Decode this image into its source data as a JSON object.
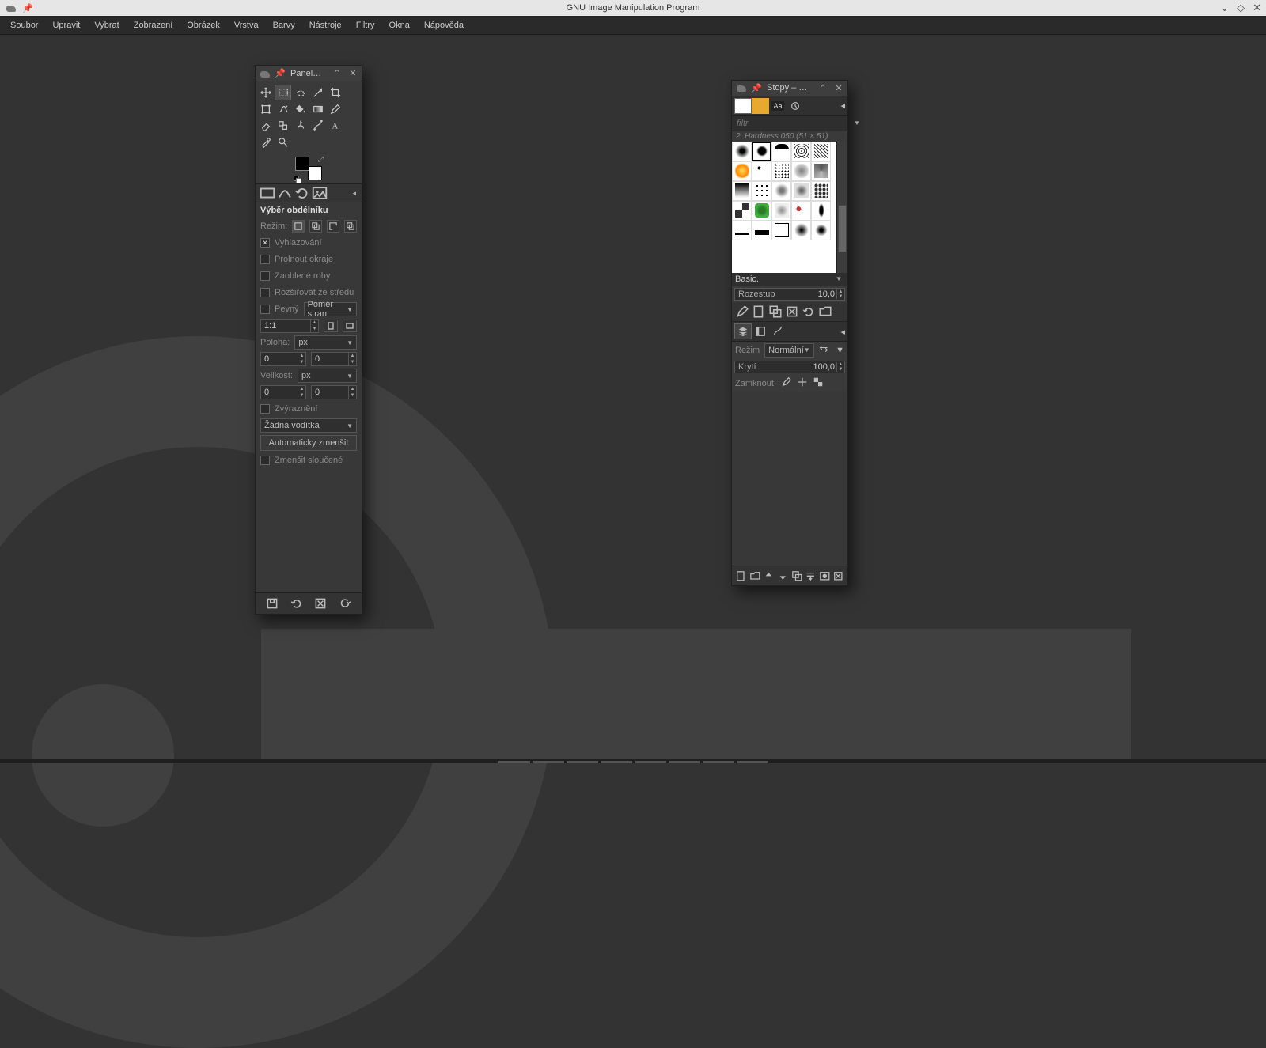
{
  "app": {
    "title": "GNU Image Manipulation Program"
  },
  "menu": [
    "Soubor",
    "Upravit",
    "Vybrat",
    "Zobrazení",
    "Obrázek",
    "Vrstva",
    "Barvy",
    "Nástroje",
    "Filtry",
    "Okna",
    "Nápověda"
  ],
  "toolbox_panel": {
    "title": "Panel…troje",
    "options_title": "Výběr obdélníku",
    "mode_label": "Režim:",
    "antialias": "Vyhlazování",
    "feather": "Prolnout okraje",
    "rounded": "Zaoblené rohy",
    "expand_center": "Rozšiřovat ze středu",
    "fixed": "Pevný",
    "fixed_mode": "Poměr stran",
    "ratio": "1:1",
    "position_label": "Poloha:",
    "px": "px",
    "pos_x": "0",
    "pos_y": "0",
    "size_label": "Velikost:",
    "size_w": "0",
    "size_h": "0",
    "highlight": "Zvýraznění",
    "guides": "Žádná vodítka",
    "autoshrink": "Automaticky zmenšit",
    "shrink_merged": "Zmenšit sloučené"
  },
  "brushes_panel": {
    "title": "Stopy – Vrstvy",
    "filter_placeholder": "filtr",
    "brush_caption": "2. Hardness 050 (51 × 51)",
    "brush_preset": "Basic.",
    "spacing_label": "Rozestup",
    "spacing_value": "10,0",
    "mode_label": "Režim",
    "mode_value": "Normální",
    "opacity_label": "Krytí",
    "opacity_value": "100,0",
    "lock_label": "Zamknout:"
  }
}
